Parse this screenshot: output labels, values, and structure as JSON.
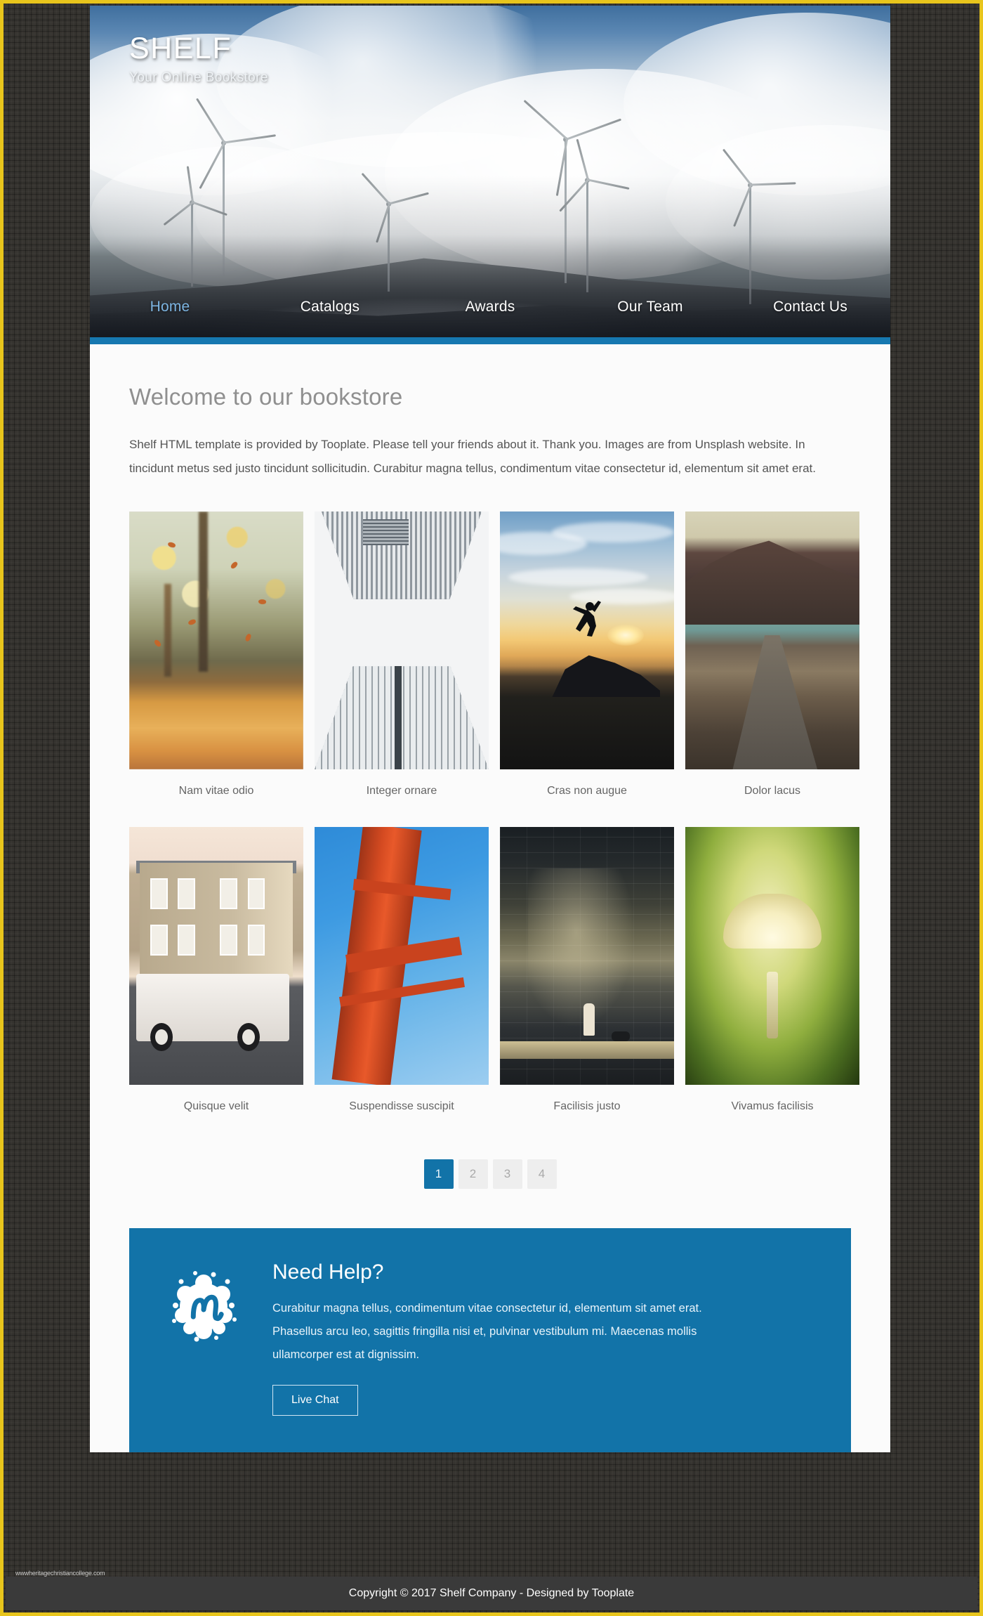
{
  "brand": {
    "name": "SHELF",
    "tagline": "Your Online Bookstore"
  },
  "nav": {
    "items": [
      {
        "label": "Home",
        "active": true
      },
      {
        "label": "Catalogs",
        "active": false
      },
      {
        "label": "Awards",
        "active": false
      },
      {
        "label": "Our Team",
        "active": false
      },
      {
        "label": "Contact Us",
        "active": false
      }
    ]
  },
  "main": {
    "title": "Welcome to our bookstore",
    "intro": "Shelf HTML template is provided by Tooplate. Please tell your friends about it. Thank you. Images are from Unsplash website. In tincidunt metus sed justo tincidunt sollicitudin. Curabitur magna tellus, condimentum vitae consectetur id, elementum sit amet erat."
  },
  "gallery": {
    "rows": [
      [
        {
          "caption": "Nam vitae odio",
          "image": "autumn-forest-falling-leaves"
        },
        {
          "caption": "Integer ornare",
          "image": "skyscrapers-looking-up"
        },
        {
          "caption": "Cras non augue",
          "image": "person-jumping-sunset-silhouette"
        },
        {
          "caption": "Dolor lacus",
          "image": "mountain-road-coast"
        }
      ],
      [
        {
          "caption": "Quisque velit",
          "image": "white-land-rover-parked-house"
        },
        {
          "caption": "Suspendisse suscipit",
          "image": "red-bridge-tower-blue-sky"
        },
        {
          "caption": "Facilisis justo",
          "image": "child-with-dog-stone-wall"
        },
        {
          "caption": "Vivamus facilisis",
          "image": "mushroom-in-moss"
        }
      ]
    ]
  },
  "pagination": {
    "pages": [
      {
        "label": "1",
        "active": true
      },
      {
        "label": "2",
        "active": false
      },
      {
        "label": "3",
        "active": false
      },
      {
        "label": "4",
        "active": false
      }
    ]
  },
  "help": {
    "icon": "meetup-logo-icon",
    "heading": "Need Help?",
    "body": "Curabitur magna tellus, condimentum vitae consectetur id, elementum sit amet erat. Phasellus arcu leo, sagittis fringilla nisi et, pulvinar vestibulum mi. Maecenas mollis ullamcorper est at dignissim.",
    "button_label": "Live Chat"
  },
  "footer": {
    "copyright": "Copyright © 2017 Shelf Company - Designed by Tooplate"
  },
  "watermark": {
    "text": "wwwheritagechristiancollege.com"
  },
  "colors": {
    "accent_blue": "#1273a8",
    "nav_accent": "#1678b0",
    "active_nav_link": "#7db5e2",
    "page_border": "#e8c51c",
    "footer_bg": "#3a3a3a",
    "body_bg": "#35332f",
    "content_bg": "#fbfbfb"
  }
}
